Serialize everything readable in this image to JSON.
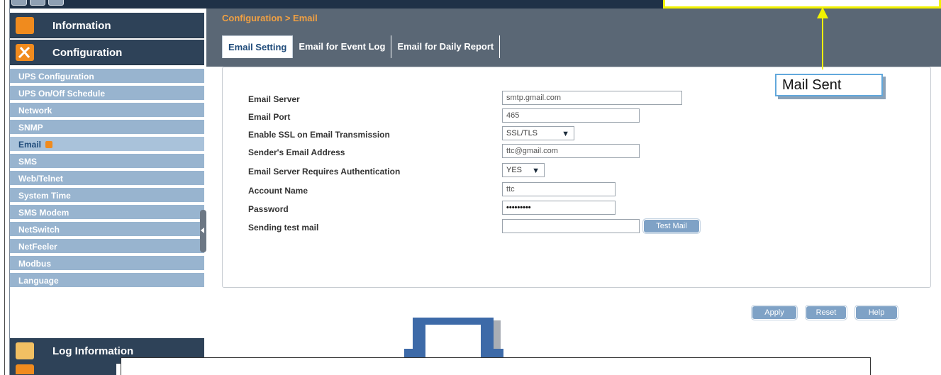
{
  "sidebar": {
    "headers": [
      {
        "label": "Information",
        "icon": "info-panel-icon"
      },
      {
        "label": "Configuration",
        "icon": "tools-icon"
      },
      {
        "label": "Log Information",
        "icon": "folder-icon"
      }
    ],
    "items": [
      {
        "label": "UPS Configuration"
      },
      {
        "label": "UPS On/Off Schedule"
      },
      {
        "label": "Network"
      },
      {
        "label": "SNMP"
      },
      {
        "label": "Email",
        "active": true
      },
      {
        "label": "SMS"
      },
      {
        "label": "Web/Telnet"
      },
      {
        "label": "System Time"
      },
      {
        "label": "SMS Modem"
      },
      {
        "label": "NetSwitch"
      },
      {
        "label": "NetFeeler"
      },
      {
        "label": "Modbus"
      },
      {
        "label": "Language"
      }
    ]
  },
  "main": {
    "breadcrumb": "Configuration > Email",
    "tabs": [
      {
        "label": "Email Setting",
        "active": true
      },
      {
        "label": "Email for Event Log"
      },
      {
        "label": "Email for Daily Report"
      }
    ],
    "form": {
      "email_server": {
        "label": "Email Server",
        "value": "smtp.gmail.com"
      },
      "email_port": {
        "label": "Email Port",
        "value": "465"
      },
      "ssl": {
        "label": "Enable SSL on Email Transmission",
        "value": "SSL/TLS"
      },
      "sender": {
        "label": "Sender's Email Address",
        "value": "ttc@gmail.com"
      },
      "auth": {
        "label": "Email Server Requires Authentication",
        "value": "YES"
      },
      "account": {
        "label": "Account Name",
        "value": "ttc"
      },
      "password": {
        "label": "Password",
        "value": "•••••••••"
      },
      "test_mail": {
        "label": "Sending test mail",
        "value": ""
      }
    },
    "buttons": {
      "test_mail": "Test Mail",
      "apply": "Apply",
      "reset": "Reset",
      "help": "Help"
    }
  },
  "annotation": {
    "callout": "Mail Sent"
  },
  "colors": {
    "header_bg": "#5a6775",
    "sidebar_head_bg": "#2e4258",
    "sidebar_item_bg": "#98b4cf",
    "accent_orange": "#f08b1e",
    "highlight_yellow": "#f2f200",
    "arrow_blue": "#3d6aa8"
  }
}
